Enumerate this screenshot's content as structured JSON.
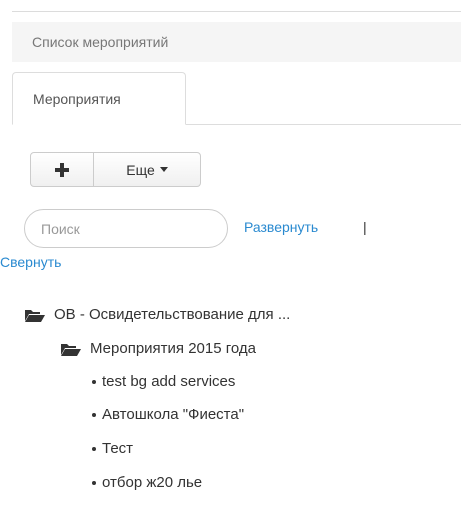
{
  "breadcrumb": {
    "label": "Список мероприятий"
  },
  "tabs": [
    {
      "label": "Мероприятия"
    }
  ],
  "toolbar": {
    "add_icon": "plus-icon",
    "more_label": "Еще",
    "more_icon": "caret-down-icon"
  },
  "search": {
    "placeholder": "Поиск",
    "value": ""
  },
  "tree_controls": {
    "expand_label": "Развернуть",
    "separator": "|",
    "collapse_label": "Свернуть"
  },
  "tree": {
    "root": {
      "label": "ОВ - Освидетельствование для ...",
      "icon": "folder-open-icon"
    },
    "group": {
      "label": "Мероприятия 2015 года",
      "icon": "folder-open-icon"
    },
    "items": [
      {
        "label": "test bg add services"
      },
      {
        "label": "Автошкола \"Фиеста\""
      },
      {
        "label": "Тест"
      },
      {
        "label": "отбор ж20 лье"
      }
    ]
  },
  "colors": {
    "link": "#2a8ad0",
    "breadcrumb_bg": "#f5f5f5",
    "text": "#333333"
  }
}
